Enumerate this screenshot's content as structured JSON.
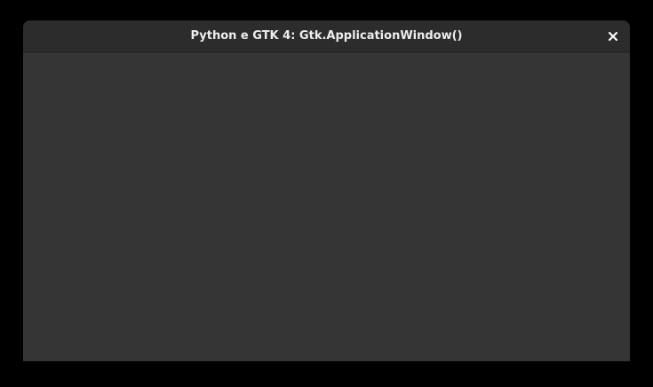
{
  "window": {
    "title": "Python e GTK 4: Gtk.ApplicationWindow()",
    "close_icon": "close-icon"
  },
  "colors": {
    "desktop_background": "#000000",
    "window_background": "#353535",
    "headerbar_background": "#2c2c2c",
    "title_text": "#eeeeee"
  }
}
